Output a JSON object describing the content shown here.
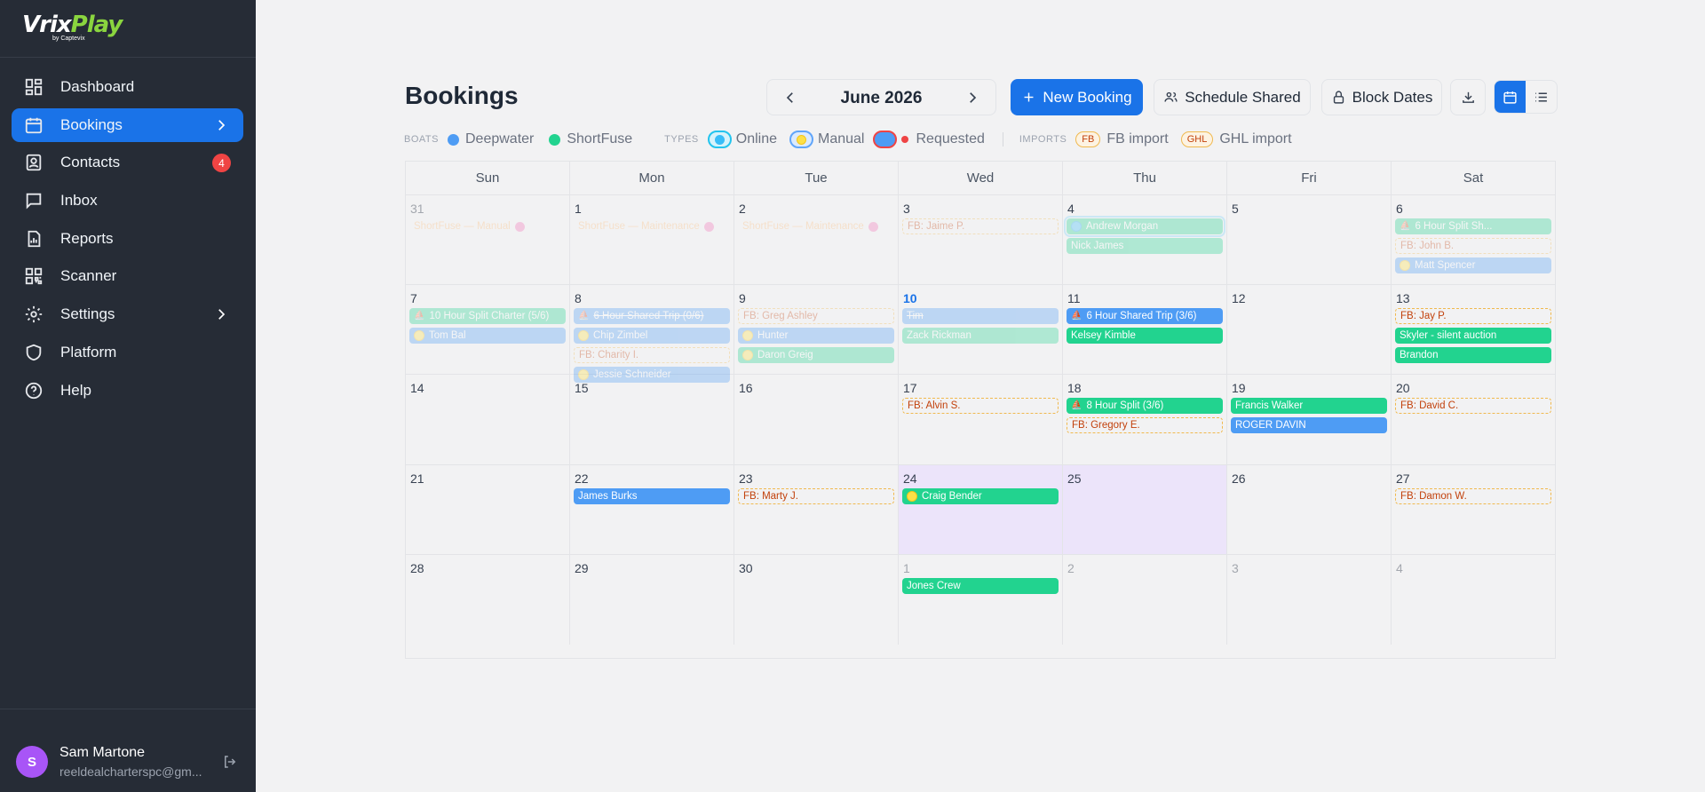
{
  "brand": {
    "name_a": "Vrix",
    "name_b": "Play",
    "sub": "by Captevix"
  },
  "nav": [
    {
      "label": "Dashboard",
      "icon": "dashboard-icon"
    },
    {
      "label": "Bookings",
      "icon": "calendar-icon",
      "active": true
    },
    {
      "label": "Contacts",
      "icon": "contacts-icon",
      "badge": "4"
    },
    {
      "label": "Inbox",
      "icon": "inbox-icon"
    },
    {
      "label": "Reports",
      "icon": "reports-icon"
    },
    {
      "label": "Scanner",
      "icon": "qr-scanner-icon"
    },
    {
      "label": "Settings",
      "icon": "gear-icon"
    },
    {
      "label": "Platform",
      "icon": "shield-icon"
    },
    {
      "label": "Help",
      "icon": "help-icon"
    }
  ],
  "user": {
    "initial": "S",
    "name": "Sam Martone",
    "email": "reeldealcharterspc@gm..."
  },
  "header": {
    "title": "Bookings",
    "month": "June 2026",
    "new_booking": "New Booking",
    "schedule_shared": "Schedule Shared",
    "block_dates": "Block Dates"
  },
  "legend": {
    "boats_cap": "BOATS",
    "boats": [
      {
        "label": "Deepwater",
        "color": "#4e9cf4"
      },
      {
        "label": "ShortFuse",
        "color": "#22d38f"
      }
    ],
    "types_cap": "TYPES",
    "types": [
      {
        "label": "Online"
      },
      {
        "label": "Manual"
      },
      {
        "label": "Requested"
      }
    ],
    "imports_cap": "IMPORTS",
    "imports": [
      {
        "tag": "FB",
        "label": "FB import"
      },
      {
        "tag": "GHL",
        "label": "GHL import"
      }
    ]
  },
  "calendar": {
    "weekdays": [
      "Sun",
      "Mon",
      "Tue",
      "Wed",
      "Thu",
      "Fri",
      "Sat"
    ],
    "weeks": [
      [
        {
          "num": "31",
          "muted": true,
          "events": [
            {
              "text": "ShortFuse — Manual",
              "kind": "text",
              "faded": true,
              "no": true
            }
          ]
        },
        {
          "num": "1",
          "events": [
            {
              "text": "ShortFuse — Maintenance",
              "kind": "text",
              "faded": true,
              "no": true
            }
          ]
        },
        {
          "num": "2",
          "events": [
            {
              "text": "ShortFuse — Maintenance",
              "kind": "text",
              "faded": true,
              "no": true
            }
          ]
        },
        {
          "num": "3",
          "events": [
            {
              "text": "FB: Jaime P.",
              "kind": "fb",
              "faded": true
            }
          ]
        },
        {
          "num": "4",
          "events": [
            {
              "text": "Andrew Morgan",
              "kind": "green",
              "faded": true,
              "icon": "online",
              "selected": true
            },
            {
              "text": "Nick James",
              "kind": "green",
              "faded": true
            }
          ]
        },
        {
          "num": "5",
          "events": []
        },
        {
          "num": "6",
          "events": [
            {
              "text": "6 Hour Split Sh...",
              "kind": "green",
              "faded": true,
              "boat": true
            },
            {
              "text": "FB: John B.",
              "kind": "fb",
              "faded": true
            },
            {
              "text": "Matt Spencer",
              "kind": "blue",
              "faded": true,
              "icon": "manual"
            }
          ]
        }
      ],
      [
        {
          "num": "7",
          "events": [
            {
              "text": "10 Hour Split Charter (5/6)",
              "kind": "green",
              "faded": true,
              "boat": true
            },
            {
              "text": "Tom Bal",
              "kind": "blue",
              "faded": true,
              "icon": "manual"
            }
          ]
        },
        {
          "num": "8",
          "events": [
            {
              "text": "6 Hour Shared Trip (0/6)",
              "kind": "blue",
              "faded": true,
              "boat": true,
              "strike": true
            },
            {
              "text": "Chip Zimbel",
              "kind": "blue",
              "faded": true,
              "icon": "manual"
            },
            {
              "text": "FB: Charity I.",
              "kind": "fb",
              "faded": true
            },
            {
              "text": "Jessie Schneider",
              "kind": "blue",
              "faded": true,
              "icon": "manual"
            }
          ]
        },
        {
          "num": "9",
          "events": [
            {
              "text": "FB: Greg Ashley",
              "kind": "fb",
              "faded": true
            },
            {
              "text": "Hunter",
              "kind": "blue",
              "faded": true,
              "icon": "manual"
            },
            {
              "text": "Daron Greig",
              "kind": "green",
              "faded": true,
              "icon": "manual"
            }
          ]
        },
        {
          "num": "10",
          "today": true,
          "events": [
            {
              "text": "Tim",
              "kind": "blue",
              "faded": true,
              "strike": true
            },
            {
              "text": "Zack Rickman",
              "kind": "green",
              "faded": true
            }
          ]
        },
        {
          "num": "11",
          "events": [
            {
              "text": "6 Hour Shared Trip (3/6)",
              "kind": "blue",
              "boat": true
            },
            {
              "text": "Kelsey Kimble",
              "kind": "green"
            }
          ]
        },
        {
          "num": "12",
          "events": []
        },
        {
          "num": "13",
          "events": [
            {
              "text": "FB: Jay P.",
              "kind": "fb"
            },
            {
              "text": "Skyler - silent auction",
              "kind": "green"
            },
            {
              "text": "Brandon",
              "kind": "green"
            }
          ]
        }
      ],
      [
        {
          "num": "14",
          "events": []
        },
        {
          "num": "15",
          "events": []
        },
        {
          "num": "16",
          "events": []
        },
        {
          "num": "17",
          "events": [
            {
              "text": "FB: Alvin S.",
              "kind": "fb"
            }
          ]
        },
        {
          "num": "18",
          "events": [
            {
              "text": "8 Hour Split (3/6)",
              "kind": "green",
              "boat": true
            },
            {
              "text": "FB: Gregory E.",
              "kind": "fb"
            }
          ]
        },
        {
          "num": "19",
          "events": [
            {
              "text": "Francis Walker",
              "kind": "green"
            },
            {
              "text": "ROGER DAVIN",
              "kind": "blue"
            }
          ]
        },
        {
          "num": "20",
          "events": [
            {
              "text": "FB: David C.",
              "kind": "fb"
            }
          ]
        }
      ],
      [
        {
          "num": "21",
          "events": []
        },
        {
          "num": "22",
          "events": [
            {
              "text": "James Burks",
              "kind": "blue"
            }
          ]
        },
        {
          "num": "23",
          "events": [
            {
              "text": "FB: Marty J.",
              "kind": "fb"
            }
          ]
        },
        {
          "num": "24",
          "hl": true,
          "events": [
            {
              "text": "Craig Bender",
              "kind": "green",
              "icon": "manual"
            }
          ]
        },
        {
          "num": "25",
          "hl": true,
          "events": []
        },
        {
          "num": "26",
          "events": []
        },
        {
          "num": "27",
          "events": [
            {
              "text": "FB: Damon W.",
              "kind": "fb"
            }
          ]
        }
      ],
      [
        {
          "num": "28",
          "events": []
        },
        {
          "num": "29",
          "events": []
        },
        {
          "num": "30",
          "events": []
        },
        {
          "num": "1",
          "muted": true,
          "events": [
            {
              "text": "Jones Crew",
              "kind": "green"
            }
          ]
        },
        {
          "num": "2",
          "muted": true,
          "events": []
        },
        {
          "num": "3",
          "muted": true,
          "events": []
        },
        {
          "num": "4",
          "muted": true,
          "events": []
        }
      ]
    ]
  }
}
